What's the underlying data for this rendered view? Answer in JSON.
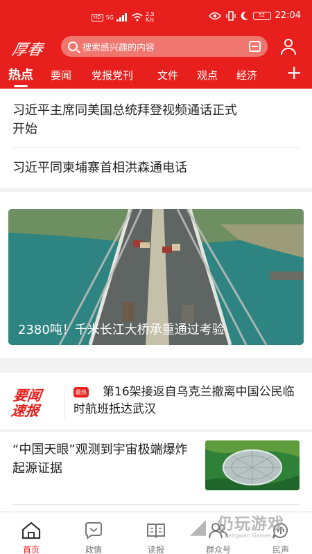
{
  "status": {
    "network_rate": "2.5",
    "network_unit": "K/s",
    "signal_label": "5G",
    "hd_label": "HD",
    "battery": "52",
    "time": "22:04"
  },
  "header": {
    "logo": "厚春",
    "search_placeholder": "搜索感兴趣的内容"
  },
  "tabs": [
    "热点",
    "要闻",
    "党报党刊",
    "文件",
    "观点",
    "经济"
  ],
  "top_headlines": [
    {
      "line1": "习近平主席同美国总统拜登视频通话正式",
      "line2": "开始"
    },
    {
      "line1": "习近平同柬埔寨首相洪森通电话"
    }
  ],
  "hero": {
    "caption": "2380吨！千米长江大桥承重通过考验"
  },
  "brief": {
    "logo_line1": "要闻",
    "logo_line2": "速报",
    "badge": "最热",
    "text": "第16架接返自乌克兰撤离中国公民临时航班抵达武汉"
  },
  "story": {
    "title": "“中国天眼”观测到宇宙极端爆炸起源证据"
  },
  "bottom_nav": [
    {
      "label": "首页",
      "icon": "home-icon"
    },
    {
      "label": "政情",
      "icon": "chat-icon"
    },
    {
      "label": "读报",
      "icon": "book-icon"
    },
    {
      "label": "群众号",
      "icon": "people-icon"
    },
    {
      "label": "民声",
      "icon": "voice-icon"
    }
  ],
  "watermark": {
    "main": "仍玩游戏",
    "sub": "Rengwan Games"
  },
  "colors": {
    "brand_red": "#e8201d",
    "text": "#222222",
    "muted": "#777777"
  }
}
